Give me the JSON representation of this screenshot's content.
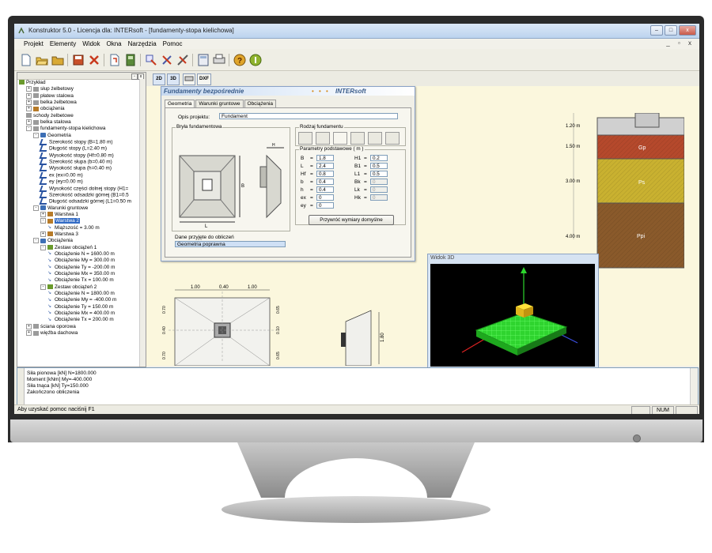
{
  "window": {
    "title": "Konstruktor 5.0 - Licencja dla: INTERsoft - [fundamenty-stopa kielichowa]",
    "min": "–",
    "max": "□",
    "close": "x"
  },
  "menu": [
    "Projekt",
    "Elementy",
    "Widok",
    "Okna",
    "Narzędzia",
    "Pomoc"
  ],
  "mdi_buttons": "_ ▫ x",
  "toolbar_icons": [
    "new-file-icon",
    "open-folder-icon",
    "folder-icon",
    "save-icon",
    "delete-icon",
    "import-icon",
    "export-icon",
    "tools-icon",
    "settings-icon",
    "cut-tools-icon",
    "calculator-icon",
    "print-icon",
    "help-icon",
    "info-icon"
  ],
  "child_toolbar": {
    "btn2d": "2D",
    "btn3d": "3D",
    "btn_print": "",
    "btn_dxf": "DXF"
  },
  "tree": {
    "items": [
      {
        "text": "Przykład",
        "level": 0,
        "icon": "green"
      },
      {
        "text": "słup żelbetowy",
        "level": 1,
        "icon": "beam",
        "exp": "+"
      },
      {
        "text": "płatew stalowa",
        "level": 1,
        "icon": "beam",
        "exp": "+"
      },
      {
        "text": "belka żelbetowa",
        "level": 1,
        "icon": "beam",
        "exp": "+"
      },
      {
        "text": "obciążenia",
        "level": 1,
        "icon": "load",
        "exp": "+"
      },
      {
        "text": "schody żelbetowe",
        "level": 1,
        "icon": "beam",
        "exp": ""
      },
      {
        "text": "belka stalowa",
        "level": 1,
        "icon": "beam",
        "exp": "+"
      },
      {
        "text": "fundamenty-stopa kielichowa",
        "level": 1,
        "icon": "beam",
        "exp": "-"
      },
      {
        "text": "Geometria",
        "level": 2,
        "icon": "folder",
        "exp": "-"
      },
      {
        "text": "Szerokość stopy (B=1.80 m)",
        "level": 3,
        "icon": "dim"
      },
      {
        "text": "Długość stopy (L=2.40 m)",
        "level": 3,
        "icon": "dim"
      },
      {
        "text": "Wysokość stopy (Hf=0.80 m)",
        "level": 3,
        "icon": "dim"
      },
      {
        "text": "Szerokość słupa (b=0.40 m)",
        "level": 3,
        "icon": "dim"
      },
      {
        "text": "Wysokość słupa (h=0.40 m)",
        "level": 3,
        "icon": "dim"
      },
      {
        "text": "ex (ex=0.00 m)",
        "level": 3,
        "icon": "dim"
      },
      {
        "text": "ey (ey=0.00 m)",
        "level": 3,
        "icon": "dim"
      },
      {
        "text": "Wysokość części dolnej stopy (H1=",
        "level": 3,
        "icon": "dim"
      },
      {
        "text": "Szerokość odsadzki górnej (B1=0.5",
        "level": 3,
        "icon": "dim"
      },
      {
        "text": "Długość odsadzki górnej (L1=0.50 m",
        "level": 3,
        "icon": "dim"
      },
      {
        "text": "Warunki gruntowe",
        "level": 2,
        "icon": "folder",
        "exp": "-"
      },
      {
        "text": "Warstwa 1",
        "level": 3,
        "icon": "load",
        "exp": "+"
      },
      {
        "text": "Warstwa 2",
        "level": 3,
        "icon": "load",
        "exp": "-",
        "selected": true
      },
      {
        "text": "Miąższość = 3.00 m",
        "level": 4,
        "icon": "arrow"
      },
      {
        "text": "Warstwa 3",
        "level": 3,
        "icon": "load",
        "exp": "+"
      },
      {
        "text": "Obciążenia",
        "level": 2,
        "icon": "folder",
        "exp": "-"
      },
      {
        "text": "Zestaw obciążeń 1",
        "level": 3,
        "icon": "green",
        "exp": "-"
      },
      {
        "text": "Obciążenie N = 1600.00 m",
        "level": 4,
        "icon": "arrow"
      },
      {
        "text": "Obciążenie My = 300.00 m",
        "level": 4,
        "icon": "arrow"
      },
      {
        "text": "Obciążenie Ty = -200.00 m",
        "level": 4,
        "icon": "arrow"
      },
      {
        "text": "Obciążenie Mx = 350.00 m",
        "level": 4,
        "icon": "arrow"
      },
      {
        "text": "Obciążenie Tx = 100.00 m",
        "level": 4,
        "icon": "arrow"
      },
      {
        "text": "Zestaw obciążeń 2",
        "level": 3,
        "icon": "green",
        "exp": "-"
      },
      {
        "text": "Obciążenie N = 1800.00 m",
        "level": 4,
        "icon": "arrow"
      },
      {
        "text": "Obciążenie My = -400.00 m",
        "level": 4,
        "icon": "arrow"
      },
      {
        "text": "Obciążenie Ty = 150.00 m",
        "level": 4,
        "icon": "arrow"
      },
      {
        "text": "Obciążenie Mx = 400.00 m",
        "level": 4,
        "icon": "arrow"
      },
      {
        "text": "Obciążenie Tx = 200.00 m",
        "level": 4,
        "icon": "arrow"
      },
      {
        "text": "ściana oporowa",
        "level": 1,
        "icon": "beam",
        "exp": "+"
      },
      {
        "text": "więźba dachowa",
        "level": 1,
        "icon": "beam",
        "exp": "+"
      }
    ]
  },
  "dialog": {
    "title": "Fundamenty bezpośrednie",
    "dots": "• • •",
    "brand": "INTERsoft",
    "tabs": [
      "Geometria",
      "Warunki gruntowe",
      "Obciążenia"
    ],
    "opis_label": "Opis projektu:",
    "opis_value": "Fundament",
    "bryla_label": "Bryła fundamentowa",
    "rodzaj_label": "Rodzaj fundamentu",
    "params_label": "Parametry podstawowe   ( m )",
    "params_left": [
      {
        "label": "B",
        "value": "1.8"
      },
      {
        "label": "L",
        "value": "2.4"
      },
      {
        "label": "Hf",
        "value": "0.8"
      },
      {
        "label": "b",
        "value": "0.4"
      },
      {
        "label": "h",
        "value": "0.4"
      },
      {
        "label": "ex",
        "value": "0"
      },
      {
        "label": "ey",
        "value": "0"
      }
    ],
    "params_right": [
      {
        "label": "H1",
        "value": "0.2",
        "disabled": false
      },
      {
        "label": "B1",
        "value": "0.5",
        "disabled": false
      },
      {
        "label": "L1",
        "value": "0.5",
        "disabled": false
      },
      {
        "label": "Bk",
        "value": "0",
        "disabled": true
      },
      {
        "label": "Lk",
        "value": "0",
        "disabled": true
      },
      {
        "label": "Hk",
        "value": "0",
        "disabled": true
      }
    ],
    "dane_label": "Dane przyjęte do obliczeń",
    "dane_value": "Geometria poprawna",
    "restore_button": "Przywróć wymiary domyślne"
  },
  "plan_dims": {
    "top": [
      "1.00",
      "0.40",
      "1.00"
    ],
    "left": [
      "0.70",
      "0.40",
      "0.70"
    ],
    "right": [
      "0.65",
      "0.10",
      "0.65"
    ],
    "section_h": "1.80"
  },
  "soil": {
    "depths": [
      "1.20 m",
      "1.50 m",
      "3.00 m",
      "4.00 m"
    ],
    "layers": [
      "Gp",
      "Ps",
      "Ppi"
    ]
  },
  "view3d": {
    "title": "Widok 3D"
  },
  "output": {
    "lines": [
      "Siła pionowa [kN] N=1800.000",
      "Moment [kNm] My=-400.000",
      "Siła tnąca [kN] Ty=150.000",
      "Zakończono obliczenia"
    ]
  },
  "status": {
    "text": "Aby uzyskać pomoc naciśnij F1",
    "num": "NUM"
  },
  "colors": {
    "selection": "#316ac5",
    "soil_gp": "#b5492c",
    "soil_ps": "#c9b130",
    "soil_ppi": "#8a5a2b",
    "grid_green": "#39e439"
  }
}
